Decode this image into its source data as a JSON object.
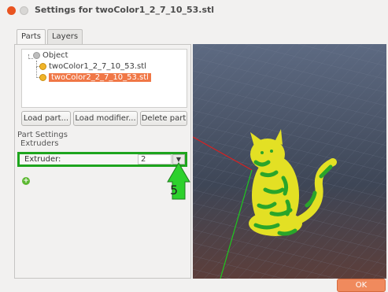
{
  "window": {
    "title": "Settings for twoColor1_2_7_10_53.stl"
  },
  "tabs": [
    {
      "label": "Parts",
      "active": true
    },
    {
      "label": "Layers",
      "active": false
    }
  ],
  "tree": {
    "root": "Object",
    "parts": [
      {
        "label": "twoColor1_2_7_10_53.stl",
        "selected": false
      },
      {
        "label": "twoColor2_2_7_10_53.stl",
        "selected": true
      }
    ]
  },
  "buttons": {
    "load_part": "Load part...",
    "load_modifier": "Load modifier...",
    "delete_part": "Delete part",
    "ok": "OK"
  },
  "part_settings": {
    "heading": "Part Settings",
    "group": "Extruders",
    "extruder_label": "Extruder:",
    "extruder_value": "2"
  },
  "annotation": {
    "step": "5"
  },
  "colors": {
    "accent": "#f07746",
    "highlight_green": "#1ea51e",
    "model_yellow": "#e3e024",
    "model_green": "#2aa52a"
  },
  "icons": {
    "add": "plus-circle-icon",
    "dropdown": "chevron-down-icon"
  }
}
